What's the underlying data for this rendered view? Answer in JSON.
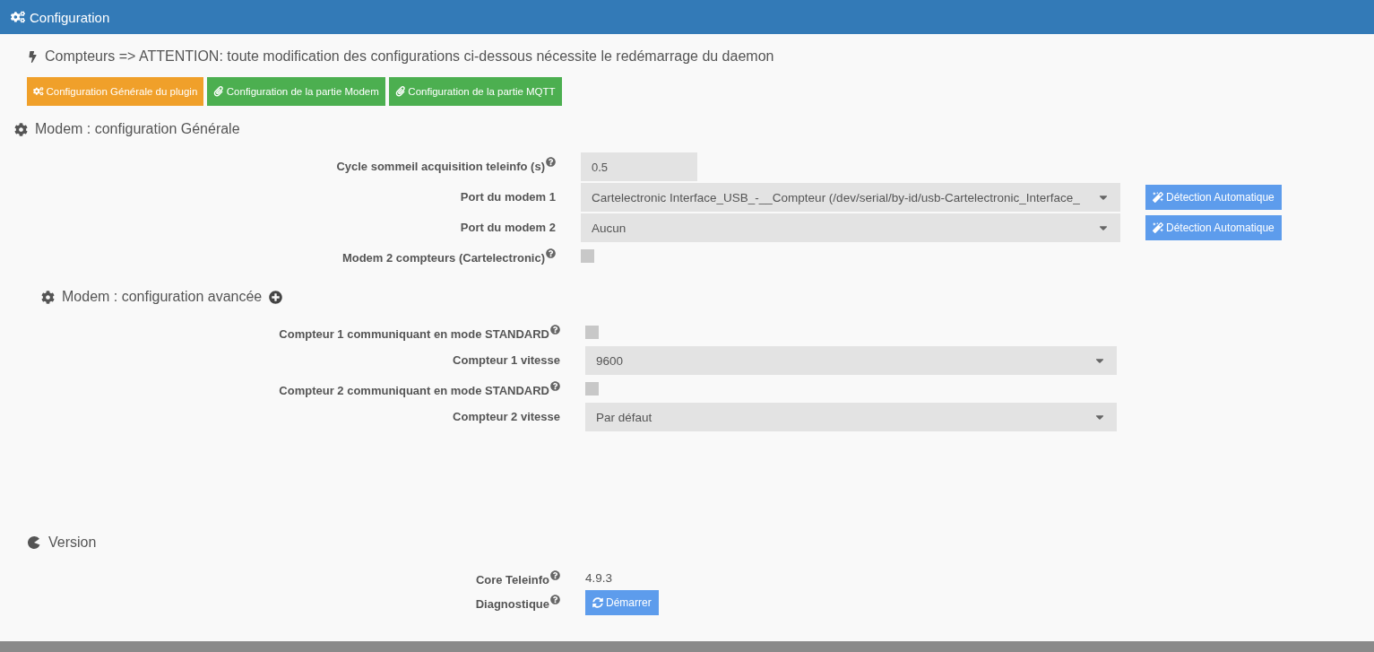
{
  "header": {
    "title": "Configuration"
  },
  "notice": "Compteurs => ATTENTION: toute modification des configurations ci-dessous nécessite le redémarrage du daemon",
  "nav_buttons": [
    {
      "label": "Configuration Générale du plugin",
      "selected": true
    },
    {
      "label": "Configuration de la partie Modem",
      "selected": false
    },
    {
      "label": "Configuration de la partie MQTT",
      "selected": false
    }
  ],
  "sections": [
    {
      "kind": "general",
      "title": "Modem : configuration Générale",
      "rows": [
        {
          "kind": "input",
          "label": "Cycle sommeil acquisition teleinfo (s)",
          "help": true,
          "value": "0.5"
        },
        {
          "kind": "select",
          "label": "Port du modem 1",
          "help": false,
          "value": "Cartelectronic Interface_USB_-__Compteur (/dev/serial/by-id/usb-Cartelectronic_Interface_",
          "action": "Détection Automatique"
        },
        {
          "kind": "select",
          "label": "Port du modem 2",
          "help": false,
          "value": "Aucun",
          "action": "Détection Automatique"
        },
        {
          "kind": "checkbox",
          "label": "Modem 2 compteurs (Cartelectronic)",
          "help": true,
          "checked": false
        }
      ]
    },
    {
      "kind": "advanced",
      "title": "Modem : configuration avancée",
      "rows": [
        {
          "kind": "checkbox",
          "label": "Compteur 1 communiquant en mode STANDARD",
          "help": true,
          "checked": false
        },
        {
          "kind": "select",
          "label": "Compteur 1 vitesse",
          "help": false,
          "value": "9600"
        },
        {
          "kind": "checkbox",
          "label": "Compteur 2 communiquant en mode STANDARD",
          "help": true,
          "checked": false
        },
        {
          "kind": "select",
          "label": "Compteur 2 vitesse",
          "help": false,
          "value": "Par défaut"
        }
      ]
    },
    {
      "kind": "version",
      "title": "Version",
      "rows": [
        {
          "kind": "text",
          "label": "Core Teleinfo",
          "help": true,
          "value": "4.9.3"
        },
        {
          "kind": "button",
          "label": "Diagnostique",
          "help": true,
          "value": "Démarrer"
        }
      ]
    }
  ]
}
